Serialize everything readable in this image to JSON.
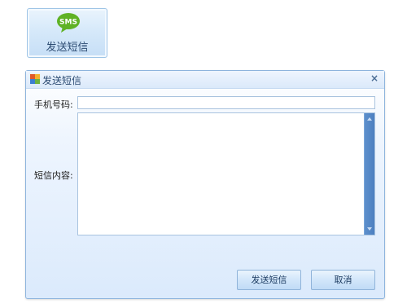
{
  "tile": {
    "icon_text": "SMS",
    "label": "发送短信"
  },
  "dialog": {
    "title": "发送短信",
    "close_glyph": "×",
    "phone_label": "手机号码:",
    "phone_value": "",
    "content_label": "短信内容:",
    "send_label": "发送短信",
    "cancel_label": "取消"
  },
  "colors": {
    "accent": "#4c7fc0",
    "sms_bubble": "#5fb225",
    "title_text": "#2c4b72"
  }
}
